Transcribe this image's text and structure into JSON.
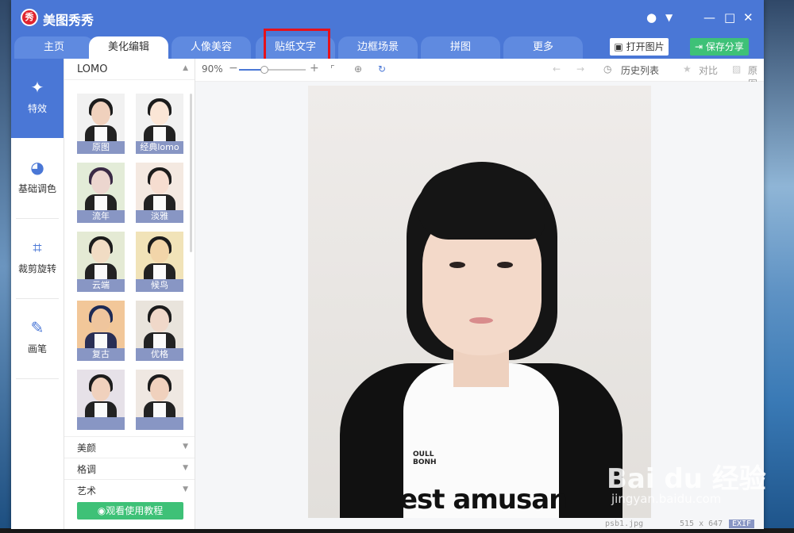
{
  "app": {
    "title": "美图秀秀",
    "logo_char": "秀"
  },
  "window_controls": {
    "chat": "●",
    "menu": "▼",
    "minimize": "—",
    "maximize": "□",
    "close": "✕"
  },
  "tabs": [
    {
      "label": "主页"
    },
    {
      "label": "美化编辑",
      "active": true
    },
    {
      "label": "人像美容"
    },
    {
      "label": "贴纸文字",
      "highlighted": true
    },
    {
      "label": "边框场景"
    },
    {
      "label": "拼图"
    },
    {
      "label": "更多"
    }
  ],
  "actions": {
    "open_image": "打开图片",
    "save_share": "保存分享"
  },
  "left_nav": [
    {
      "label": "特效",
      "icon": "magic-wand-icon",
      "active": true
    },
    {
      "label": "基础调色",
      "icon": "palette-icon"
    },
    {
      "label": "裁剪旋转",
      "icon": "crop-icon"
    },
    {
      "label": "画笔",
      "icon": "brush-icon"
    }
  ],
  "effects_panel": {
    "title": "LOMO",
    "thumbnails": [
      "原图",
      "经典lomo",
      "流年",
      "淡雅",
      "云端",
      "候鸟",
      "复古",
      "优格",
      "",
      ""
    ],
    "sections": [
      "美颜",
      "格调",
      "艺术"
    ],
    "tutorial_button": "观看使用教程"
  },
  "toolbar": {
    "zoom": "90%",
    "history": "历史列表",
    "compare": "对比",
    "original": "原图"
  },
  "photo_text": {
    "line1": "OULL",
    "line2": "BONH",
    "line3": "est amusan"
  },
  "status": {
    "filename": "psb1.jpg",
    "dimensions": "515 x 647",
    "exif": "EXIF"
  },
  "watermark": {
    "brand": "Bai du 经验",
    "url": "jingyan.baidu.com"
  },
  "colors": {
    "brand_blue": "#4a77d6",
    "green": "#3ec177",
    "highlight_red": "#e5121b",
    "logo_red": "#e0242e"
  }
}
